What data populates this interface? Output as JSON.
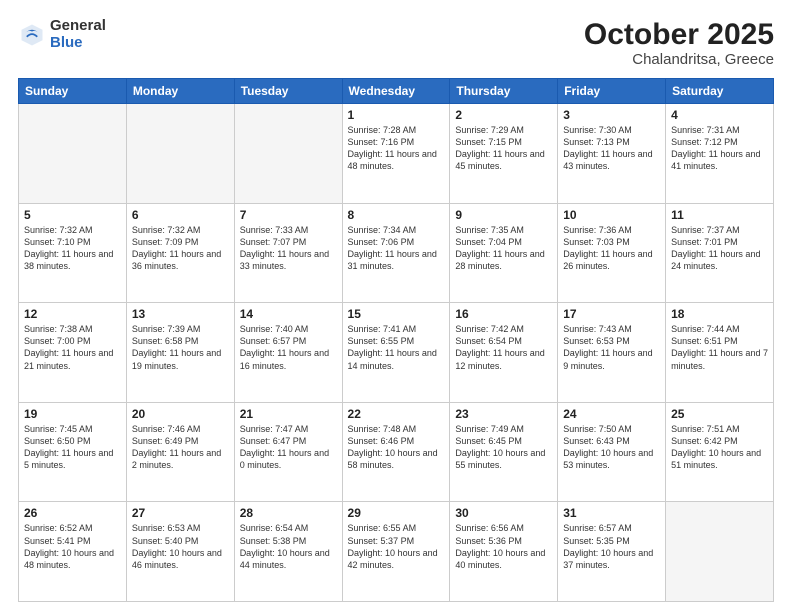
{
  "header": {
    "logo_general": "General",
    "logo_blue": "Blue",
    "title": "October 2025",
    "subtitle": "Chalandritsa, Greece"
  },
  "calendar": {
    "days_of_week": [
      "Sunday",
      "Monday",
      "Tuesday",
      "Wednesday",
      "Thursday",
      "Friday",
      "Saturday"
    ],
    "weeks": [
      [
        {
          "day": "",
          "empty": true
        },
        {
          "day": "",
          "empty": true
        },
        {
          "day": "",
          "empty": true
        },
        {
          "day": "1",
          "sunrise": "7:28 AM",
          "sunset": "7:16 PM",
          "daylight": "11 hours and 48 minutes."
        },
        {
          "day": "2",
          "sunrise": "7:29 AM",
          "sunset": "7:15 PM",
          "daylight": "11 hours and 45 minutes."
        },
        {
          "day": "3",
          "sunrise": "7:30 AM",
          "sunset": "7:13 PM",
          "daylight": "11 hours and 43 minutes."
        },
        {
          "day": "4",
          "sunrise": "7:31 AM",
          "sunset": "7:12 PM",
          "daylight": "11 hours and 41 minutes."
        }
      ],
      [
        {
          "day": "5",
          "sunrise": "7:32 AM",
          "sunset": "7:10 PM",
          "daylight": "11 hours and 38 minutes."
        },
        {
          "day": "6",
          "sunrise": "7:32 AM",
          "sunset": "7:09 PM",
          "daylight": "11 hours and 36 minutes."
        },
        {
          "day": "7",
          "sunrise": "7:33 AM",
          "sunset": "7:07 PM",
          "daylight": "11 hours and 33 minutes."
        },
        {
          "day": "8",
          "sunrise": "7:34 AM",
          "sunset": "7:06 PM",
          "daylight": "11 hours and 31 minutes."
        },
        {
          "day": "9",
          "sunrise": "7:35 AM",
          "sunset": "7:04 PM",
          "daylight": "11 hours and 28 minutes."
        },
        {
          "day": "10",
          "sunrise": "7:36 AM",
          "sunset": "7:03 PM",
          "daylight": "11 hours and 26 minutes."
        },
        {
          "day": "11",
          "sunrise": "7:37 AM",
          "sunset": "7:01 PM",
          "daylight": "11 hours and 24 minutes."
        }
      ],
      [
        {
          "day": "12",
          "sunrise": "7:38 AM",
          "sunset": "7:00 PM",
          "daylight": "11 hours and 21 minutes."
        },
        {
          "day": "13",
          "sunrise": "7:39 AM",
          "sunset": "6:58 PM",
          "daylight": "11 hours and 19 minutes."
        },
        {
          "day": "14",
          "sunrise": "7:40 AM",
          "sunset": "6:57 PM",
          "daylight": "11 hours and 16 minutes."
        },
        {
          "day": "15",
          "sunrise": "7:41 AM",
          "sunset": "6:55 PM",
          "daylight": "11 hours and 14 minutes."
        },
        {
          "day": "16",
          "sunrise": "7:42 AM",
          "sunset": "6:54 PM",
          "daylight": "11 hours and 12 minutes."
        },
        {
          "day": "17",
          "sunrise": "7:43 AM",
          "sunset": "6:53 PM",
          "daylight": "11 hours and 9 minutes."
        },
        {
          "day": "18",
          "sunrise": "7:44 AM",
          "sunset": "6:51 PM",
          "daylight": "11 hours and 7 minutes."
        }
      ],
      [
        {
          "day": "19",
          "sunrise": "7:45 AM",
          "sunset": "6:50 PM",
          "daylight": "11 hours and 5 minutes."
        },
        {
          "day": "20",
          "sunrise": "7:46 AM",
          "sunset": "6:49 PM",
          "daylight": "11 hours and 2 minutes."
        },
        {
          "day": "21",
          "sunrise": "7:47 AM",
          "sunset": "6:47 PM",
          "daylight": "11 hours and 0 minutes."
        },
        {
          "day": "22",
          "sunrise": "7:48 AM",
          "sunset": "6:46 PM",
          "daylight": "10 hours and 58 minutes."
        },
        {
          "day": "23",
          "sunrise": "7:49 AM",
          "sunset": "6:45 PM",
          "daylight": "10 hours and 55 minutes."
        },
        {
          "day": "24",
          "sunrise": "7:50 AM",
          "sunset": "6:43 PM",
          "daylight": "10 hours and 53 minutes."
        },
        {
          "day": "25",
          "sunrise": "7:51 AM",
          "sunset": "6:42 PM",
          "daylight": "10 hours and 51 minutes."
        }
      ],
      [
        {
          "day": "26",
          "sunrise": "6:52 AM",
          "sunset": "5:41 PM",
          "daylight": "10 hours and 48 minutes."
        },
        {
          "day": "27",
          "sunrise": "6:53 AM",
          "sunset": "5:40 PM",
          "daylight": "10 hours and 46 minutes."
        },
        {
          "day": "28",
          "sunrise": "6:54 AM",
          "sunset": "5:38 PM",
          "daylight": "10 hours and 44 minutes."
        },
        {
          "day": "29",
          "sunrise": "6:55 AM",
          "sunset": "5:37 PM",
          "daylight": "10 hours and 42 minutes."
        },
        {
          "day": "30",
          "sunrise": "6:56 AM",
          "sunset": "5:36 PM",
          "daylight": "10 hours and 40 minutes."
        },
        {
          "day": "31",
          "sunrise": "6:57 AM",
          "sunset": "5:35 PM",
          "daylight": "10 hours and 37 minutes."
        },
        {
          "day": "",
          "empty": true
        }
      ]
    ]
  }
}
